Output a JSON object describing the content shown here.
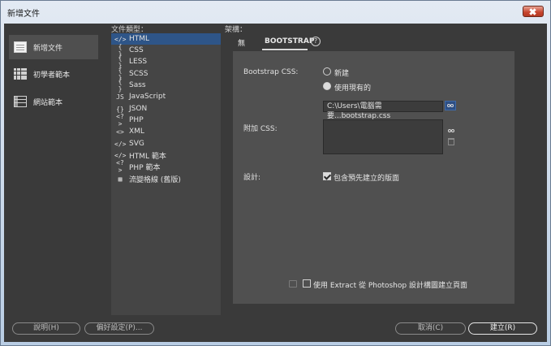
{
  "window": {
    "title": "新增文件"
  },
  "categories": [
    {
      "label": "新增文件",
      "icon": "document-icon",
      "selected": true
    },
    {
      "label": "初學者範本",
      "icon": "grid-template-icon",
      "selected": false
    },
    {
      "label": "網站範本",
      "icon": "site-template-icon",
      "selected": false
    }
  ],
  "file_types": {
    "label": "文件類型：",
    "items": [
      {
        "glyph": "</>",
        "label": "HTML",
        "selected": true
      },
      {
        "glyph": "{ }",
        "label": "CSS"
      },
      {
        "glyph": "{ }",
        "label": "LESS"
      },
      {
        "glyph": "{ }",
        "label": "SCSS"
      },
      {
        "glyph": "{ }",
        "label": "Sass"
      },
      {
        "glyph": "JS",
        "label": "JavaScript"
      },
      {
        "glyph": "{}",
        "label": "JSON"
      },
      {
        "glyph": "<?>",
        "label": "PHP"
      },
      {
        "glyph": "<>",
        "label": "XML"
      },
      {
        "glyph": "</>",
        "label": "SVG"
      },
      {
        "glyph": "</>",
        "label": "HTML 範本"
      },
      {
        "glyph": "<?>",
        "label": "PHP 範本"
      },
      {
        "glyph": "▦",
        "label": "流變格線 (舊版)"
      }
    ]
  },
  "framework": {
    "label": "架構：",
    "tabs": [
      {
        "label": "無"
      },
      {
        "label": "BOOTSTRAP",
        "active": true
      }
    ],
    "help_glyph": "?"
  },
  "bootstrap": {
    "css_label": "Bootstrap CSS:",
    "option_new": "新建",
    "option_existing": "使用現有的",
    "selected_option": "existing",
    "css_path": "C:\\Users\\電腦需要...bootstrap.css",
    "attach_label": "附加 CSS:",
    "design_label": "設計:",
    "include_prebuilt_label": "包含預先建立的版面",
    "include_prebuilt_checked": true,
    "extract_label": "使用 Extract 從 Photoshop 設計構圖建立頁面",
    "extract_checked": false
  },
  "footer": {
    "help": "說明(H)",
    "prefs": "偏好設定(P)...",
    "cancel": "取消(C)",
    "create": "建立(R)"
  }
}
